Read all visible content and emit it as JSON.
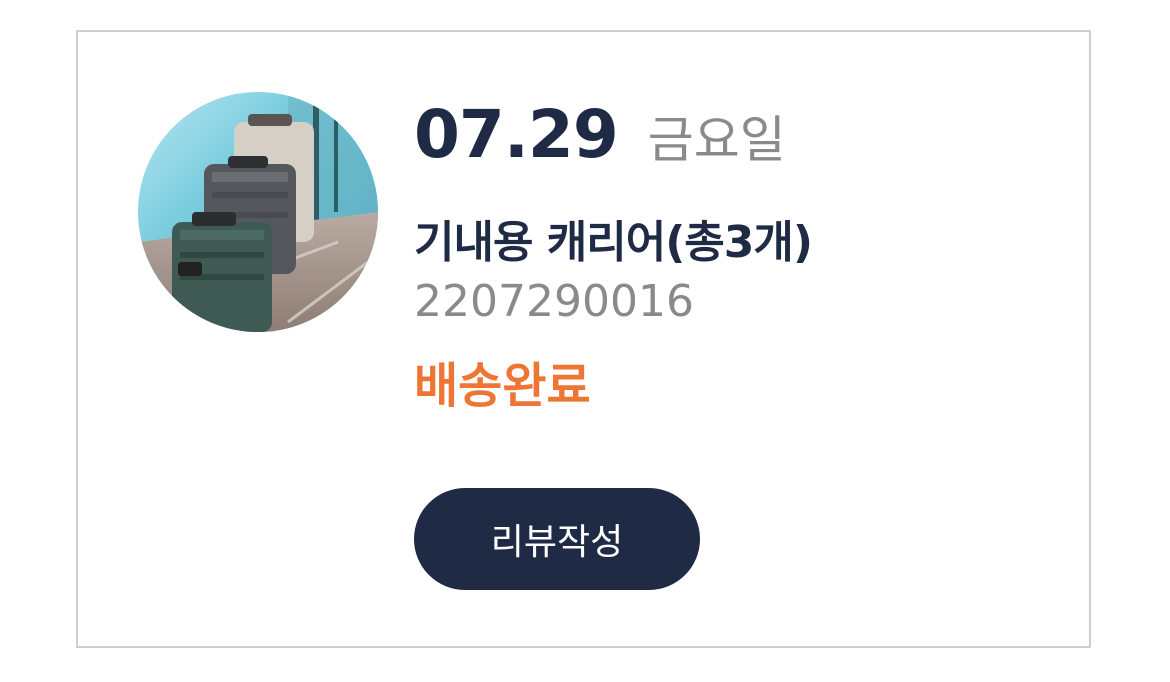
{
  "order": {
    "date": "07.29",
    "weekday": "금요일",
    "product_name": "기내용 캐리어(총3개)",
    "order_number": "2207290016",
    "status": "배송완료",
    "review_button_label": "리뷰작성"
  },
  "colors": {
    "primary_navy": "#1f2a44",
    "status_orange": "#ee7533",
    "muted_gray": "#8a8a8a",
    "border_gray": "#cfcfcf"
  },
  "thumbnail": {
    "icon": "luggage-photo"
  }
}
